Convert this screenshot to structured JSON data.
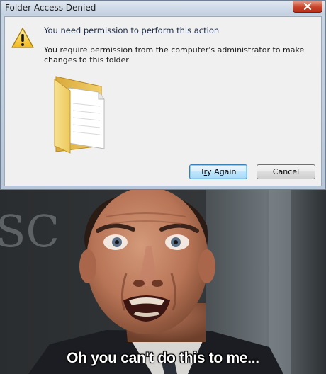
{
  "dialog": {
    "title": "Folder Access Denied",
    "close_glyph": "x",
    "heading": "You need permission to perform this action",
    "message": "You require permission from the computer's administrator to make changes to this folder",
    "try_again": {
      "before": "T",
      "mnemonic": "r",
      "after": "y Again"
    },
    "cancel_label": "Cancel",
    "icons": {
      "warning": "warning-icon",
      "folder": "folder-icon",
      "close": "close-icon"
    }
  },
  "photo": {
    "background_letters": "SC",
    "caption": "Oh you can't do this to me..."
  }
}
